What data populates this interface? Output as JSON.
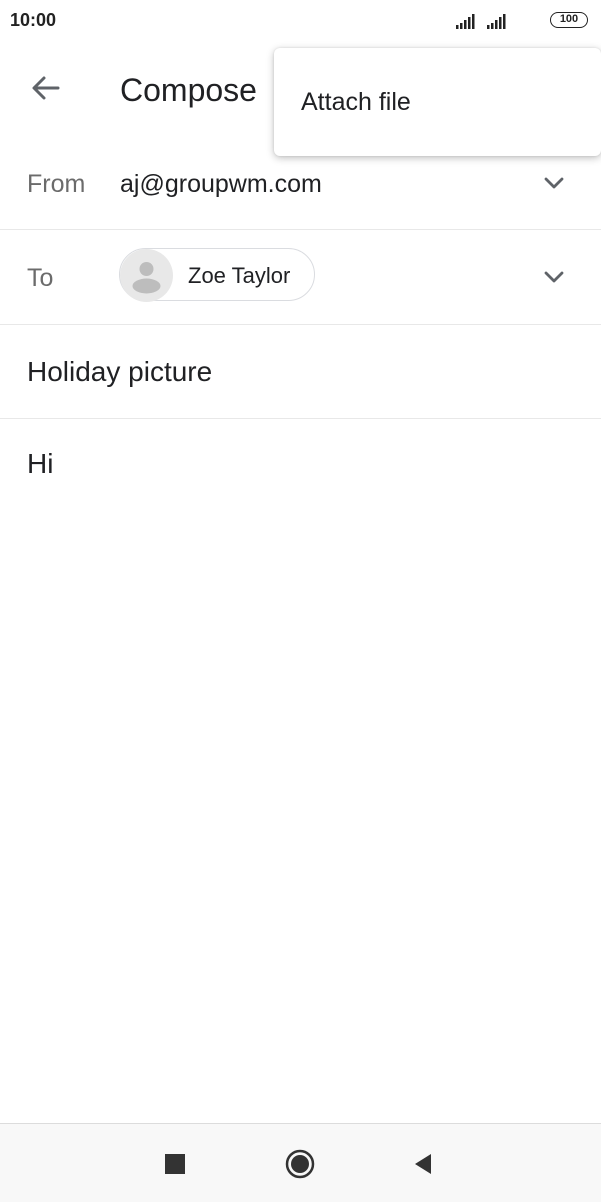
{
  "status_bar": {
    "time": "10:00",
    "battery": "100",
    "icons": [
      "signal-icon",
      "signal-icon",
      "battery-icon"
    ]
  },
  "header": {
    "title": "Compose",
    "back_icon": "arrow-left-icon"
  },
  "menu": {
    "items": [
      {
        "label": "Attach file"
      }
    ]
  },
  "from": {
    "label": "From",
    "value": "aj@groupwm.com"
  },
  "to": {
    "label": "To",
    "recipients": [
      {
        "name": "Zoe Taylor"
      }
    ]
  },
  "subject": {
    "value": "Holiday picture"
  },
  "body": {
    "value": "Hi"
  },
  "nav": {
    "icons": [
      "square-icon",
      "home-circle-icon",
      "back-triangle-icon"
    ]
  }
}
